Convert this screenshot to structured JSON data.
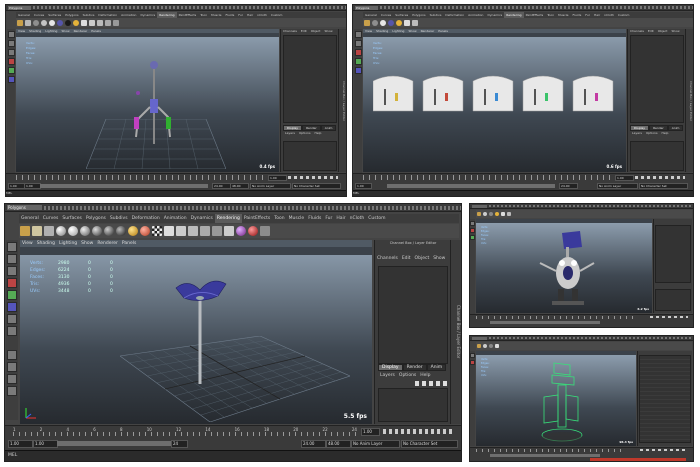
{
  "app": {
    "menu_select": "Polygons"
  },
  "shelf": {
    "tabs": [
      "General",
      "Curves",
      "Surfaces",
      "Polygons",
      "Subdivs",
      "Deformation",
      "Animation",
      "Dynamics",
      "Rendering",
      "PaintEffects",
      "Toon",
      "Muscle",
      "Fluids",
      "Fur",
      "Hair",
      "nCloth",
      "Custom"
    ],
    "active_tab": "Rendering"
  },
  "viewport": {
    "menu": [
      "View",
      "Shading",
      "Lighting",
      "Show",
      "Renderer",
      "Panels"
    ]
  },
  "hud": {
    "labels": [
      "Verts:",
      "Edges:",
      "Faces:",
      "Tris:",
      "UVs:"
    ],
    "main_values": [
      [
        "2980",
        "0",
        "0"
      ],
      [
        "6224",
        "0",
        "0"
      ],
      [
        "3130",
        "0",
        "0"
      ],
      [
        "4936",
        "0",
        "0"
      ],
      [
        "3448",
        "0",
        "0"
      ]
    ]
  },
  "channel_box": {
    "title": "Channel Box / Layer Editor",
    "menu": [
      "Channels",
      "Edit",
      "Object",
      "Show"
    ],
    "side_tab": "Channel Box / Layer Editor",
    "layer_tabs": [
      "Display",
      "Render",
      "Anim"
    ],
    "layer_menu": [
      "Layers",
      "Options",
      "Help"
    ]
  },
  "timeline": {
    "tick_labels": [
      "1",
      "2",
      "4",
      "6",
      "8",
      "10",
      "12",
      "14",
      "16",
      "18",
      "20",
      "22",
      "24"
    ],
    "current_frame": "1.00",
    "start": "1.00",
    "range_start": "1.00",
    "range_end": "24",
    "end": "24.00",
    "end2": "48.00",
    "anim_layer": "No Anim Layer",
    "char_set": "No Character Set"
  },
  "status": {
    "label": "MEL"
  },
  "windows": [
    {
      "id": "w1",
      "fps": "0.4 fps"
    },
    {
      "id": "w2",
      "fps": "0.6 fps"
    },
    {
      "id": "w3",
      "fps": "5.5 fps"
    },
    {
      "id": "w4",
      "fps": "6.2 fps"
    },
    {
      "id": "w5",
      "fps": "96.4 fps"
    }
  ]
}
